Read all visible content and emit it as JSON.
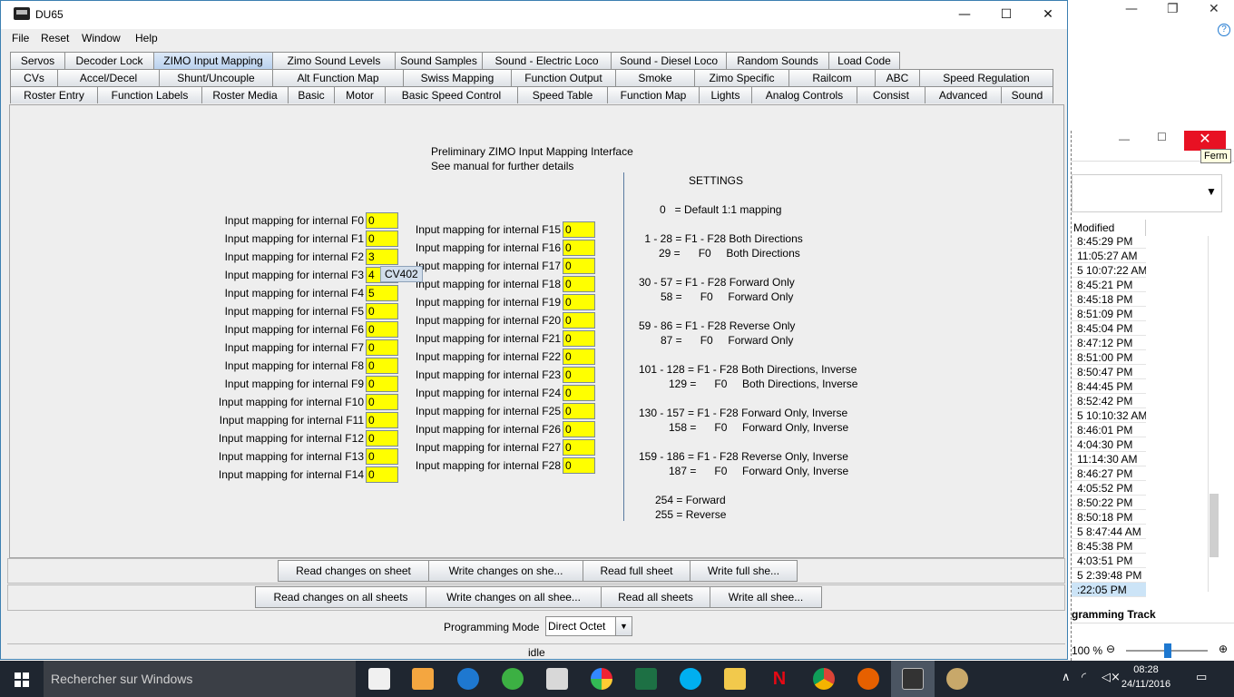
{
  "window": {
    "title": "DU65",
    "minimize": "—",
    "maximize": "☐",
    "close": "✕"
  },
  "menu": [
    "File",
    "Reset",
    "Window",
    "Help"
  ],
  "tabs": {
    "row1": [
      "Servos",
      "Decoder Lock",
      "ZIMO Input Mapping",
      "Zimo Sound Levels",
      "Sound Samples",
      "Sound - Electric Loco",
      "Sound - Diesel Loco",
      "Random Sounds",
      "Load Code"
    ],
    "row2": [
      "CVs",
      "Accel/Decel",
      "Shunt/Uncouple",
      "Alt Function Map",
      "Swiss Mapping",
      "Function Output",
      "Smoke",
      "Zimo Specific",
      "Railcom",
      "ABC",
      "Speed Regulation"
    ],
    "row3": [
      "Roster Entry",
      "Function Labels",
      "Roster Media",
      "Basic",
      "Motor",
      "Basic Speed Control",
      "Speed Table",
      "Function Map",
      "Lights",
      "Analog Controls",
      "Consist",
      "Advanced",
      "Sound"
    ],
    "active": "ZIMO Input Mapping"
  },
  "panel": {
    "heading1": "Preliminary ZIMO Input Mapping Interface",
    "heading2": "See manual for further details",
    "tooltip": "CV402",
    "left_mappings": [
      {
        "label": "Input mapping for internal F0",
        "value": "0"
      },
      {
        "label": "Input mapping for internal F1",
        "value": "0"
      },
      {
        "label": "Input mapping for internal F2",
        "value": "3"
      },
      {
        "label": "Input mapping for internal F3",
        "value": "4"
      },
      {
        "label": "Input mapping for internal F4",
        "value": "5"
      },
      {
        "label": "Input mapping for internal F5",
        "value": "0"
      },
      {
        "label": "Input mapping for internal F6",
        "value": "0"
      },
      {
        "label": "Input mapping for internal F7",
        "value": "0"
      },
      {
        "label": "Input mapping for internal F8",
        "value": "0"
      },
      {
        "label": "Input mapping for internal F9",
        "value": "0"
      },
      {
        "label": "Input mapping for internal F10",
        "value": "0"
      },
      {
        "label": "Input mapping for internal F11",
        "value": "0"
      },
      {
        "label": "Input mapping for internal F12",
        "value": "0"
      },
      {
        "label": "Input mapping for internal F13",
        "value": "0"
      },
      {
        "label": "Input mapping for internal F14",
        "value": "0"
      }
    ],
    "right_mappings": [
      {
        "label": "Input mapping for internal F15",
        "value": "0"
      },
      {
        "label": "Input mapping for internal F16",
        "value": "0"
      },
      {
        "label": "Input mapping for internal F17",
        "value": "0"
      },
      {
        "label": "Input mapping for internal F18",
        "value": "0"
      },
      {
        "label": "Input mapping for internal F19",
        "value": "0"
      },
      {
        "label": "Input mapping for internal F20",
        "value": "0"
      },
      {
        "label": "Input mapping for internal F21",
        "value": "0"
      },
      {
        "label": "Input mapping for internal F22",
        "value": "0"
      },
      {
        "label": "Input mapping for internal F23",
        "value": "0"
      },
      {
        "label": "Input mapping for internal F24",
        "value": "0"
      },
      {
        "label": "Input mapping for internal F25",
        "value": "0"
      },
      {
        "label": "Input mapping for internal F26",
        "value": "0"
      },
      {
        "label": "Input mapping for internal F27",
        "value": "0"
      },
      {
        "label": "Input mapping for internal F28",
        "value": "0"
      }
    ],
    "settings_title": "SETTINGS",
    "settings": [
      "0   = Default 1:1 mapping",
      " 1 - 28 = F1 - F28 Both Directions",
      "29 =      F0     Both Directions",
      "30 - 57 = F1 - F28 Forward Only",
      "58 =      F0     Forward Only",
      "59 - 86 = F1 - F28 Reverse Only",
      "87 =      F0     Forward Only",
      "101 - 128 = F1 - F28 Both Directions, Inverse",
      "129 =      F0     Both Directions, Inverse",
      "130 - 157 = F1 - F28 Forward Only, Inverse",
      "158 =      F0     Forward Only, Inverse",
      "159 - 186 = F1 - F28 Reverse Only, Inverse",
      "187 =      F0     Forward Only, Inverse",
      "254 = Forward",
      "255 = Reverse"
    ]
  },
  "buttons": {
    "read_changes_sheet": "Read changes on sheet",
    "write_changes_sheet": "Write changes on she...",
    "read_full_sheet": "Read full sheet",
    "write_full_sheet": "Write full she...",
    "read_changes_all": "Read changes on all sheets",
    "write_changes_all": "Write changes on all shee...",
    "read_all": "Read all sheets",
    "write_all": "Write all shee..."
  },
  "programming": {
    "label": "Programming Mode",
    "value": "Direct Octet"
  },
  "status": "idle",
  "background_window": {
    "tooltip": "Ferm",
    "column_header": "Modified",
    "rows": [
      "8:45:29 PM",
      "11:05:27 AM",
      "5 10:07:22 AM",
      "8:45:21 PM",
      "8:45:18 PM",
      "8:51:09 PM",
      "8:45:04 PM",
      "8:47:12 PM",
      "8:51:00 PM",
      "8:50:47 PM",
      "8:44:45 PM",
      "8:52:42 PM",
      "5 10:10:32 AM",
      "8:46:01 PM",
      "4:04:30 PM",
      "11:14:30 AM",
      "8:46:27 PM",
      "4:05:52 PM",
      "8:50:22 PM",
      "8:50:18 PM",
      "5 8:47:44 AM",
      "8:45:38 PM",
      "4:03:51 PM",
      "5 2:39:48 PM",
      ":22:05 PM"
    ],
    "footer": "gramming Track",
    "zoom": "100 %"
  },
  "taskbar": {
    "search_placeholder": "Rechercher sur Windows",
    "time": "08:28",
    "date": "24/11/2016"
  }
}
